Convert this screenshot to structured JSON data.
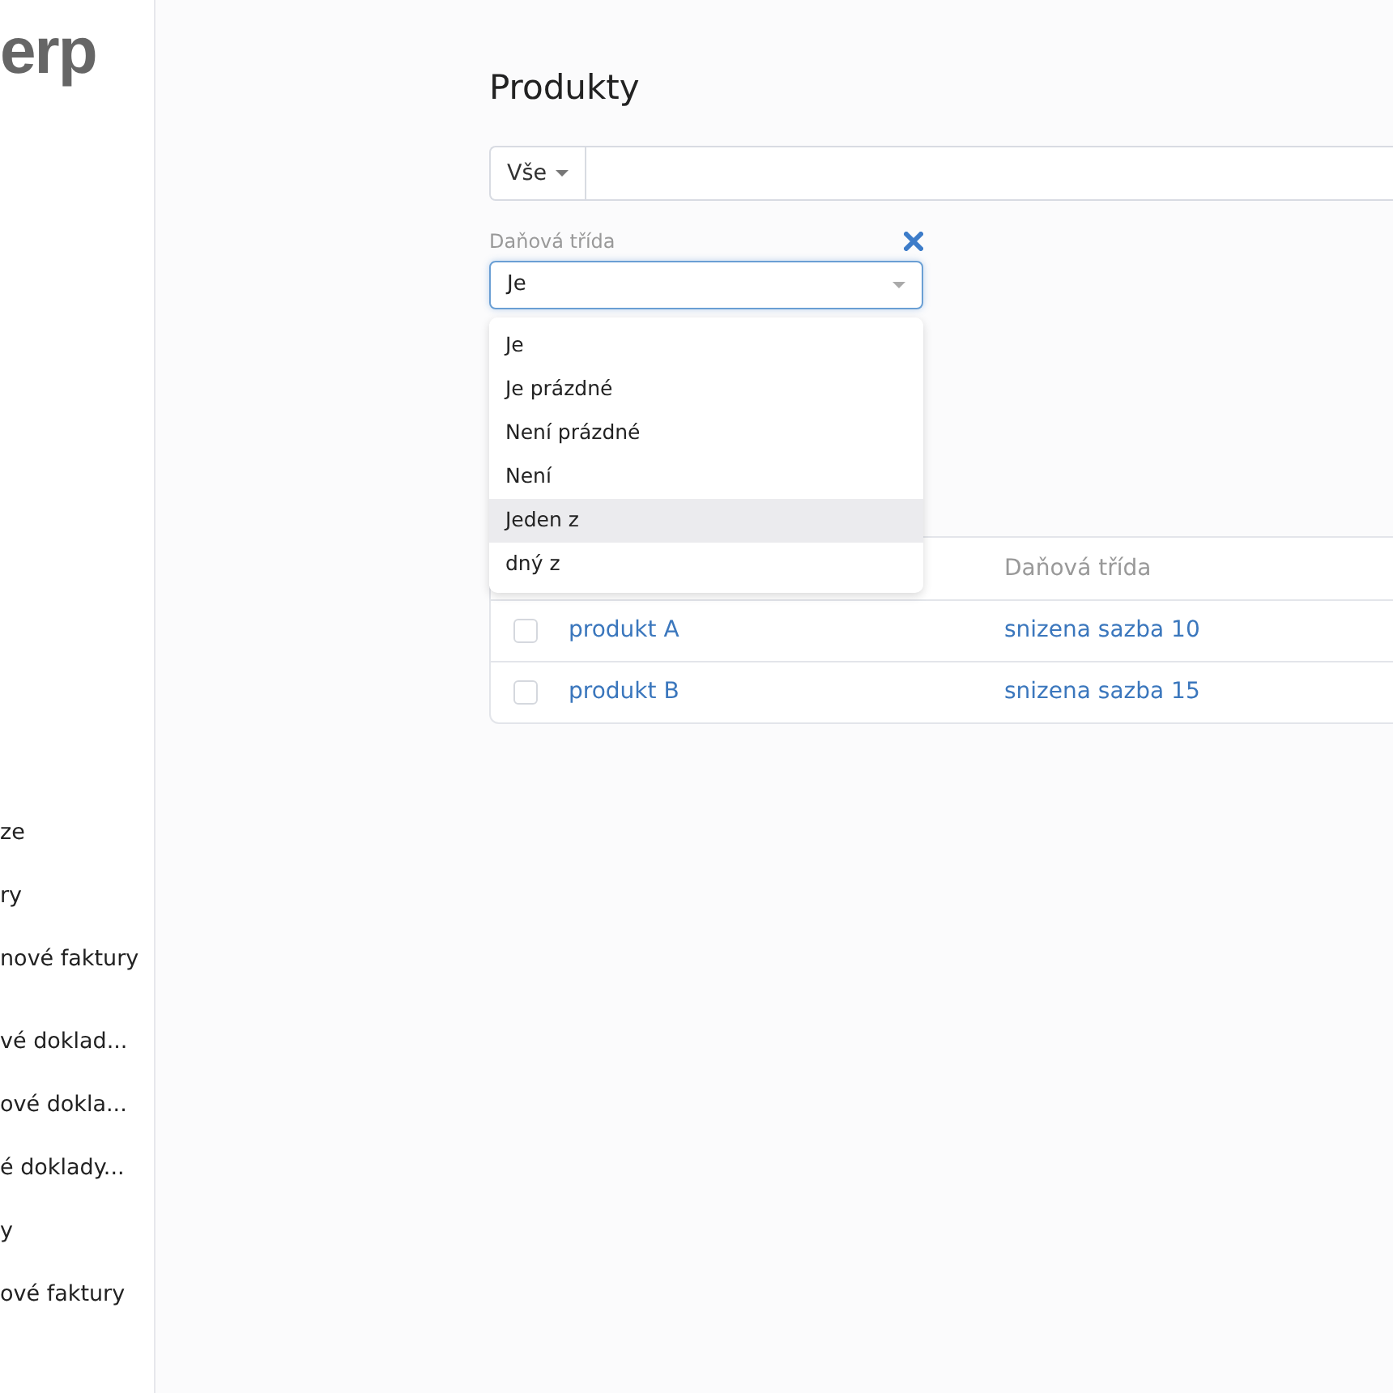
{
  "logo": "erp",
  "sidebar": {
    "groups": [
      [
        "ze",
        "ry",
        "nové faktury"
      ],
      [
        "vé doklad...",
        "ové dokla...",
        "é doklady...",
        "y",
        "ové faktury"
      ]
    ]
  },
  "page_title": "Produkty",
  "search": {
    "scope": "Vše"
  },
  "filter": {
    "label": "Daňová třída",
    "value": "Je",
    "options": [
      {
        "label": "Je",
        "highlighted": false
      },
      {
        "label": "Je prázdné",
        "highlighted": false
      },
      {
        "label": "Není prázdné",
        "highlighted": false
      },
      {
        "label": "Není",
        "highlighted": false
      },
      {
        "label": "Jeden z",
        "highlighted": true
      },
      {
        "label": "dný z",
        "highlighted": false
      }
    ]
  },
  "table": {
    "columns": [
      "Daňová třída"
    ],
    "rows": [
      {
        "checked": false,
        "name": "produkt A",
        "tax_class": "snizena sazba 10"
      },
      {
        "checked": false,
        "name": "produkt B",
        "tax_class": "snizena sazba 15"
      }
    ]
  }
}
